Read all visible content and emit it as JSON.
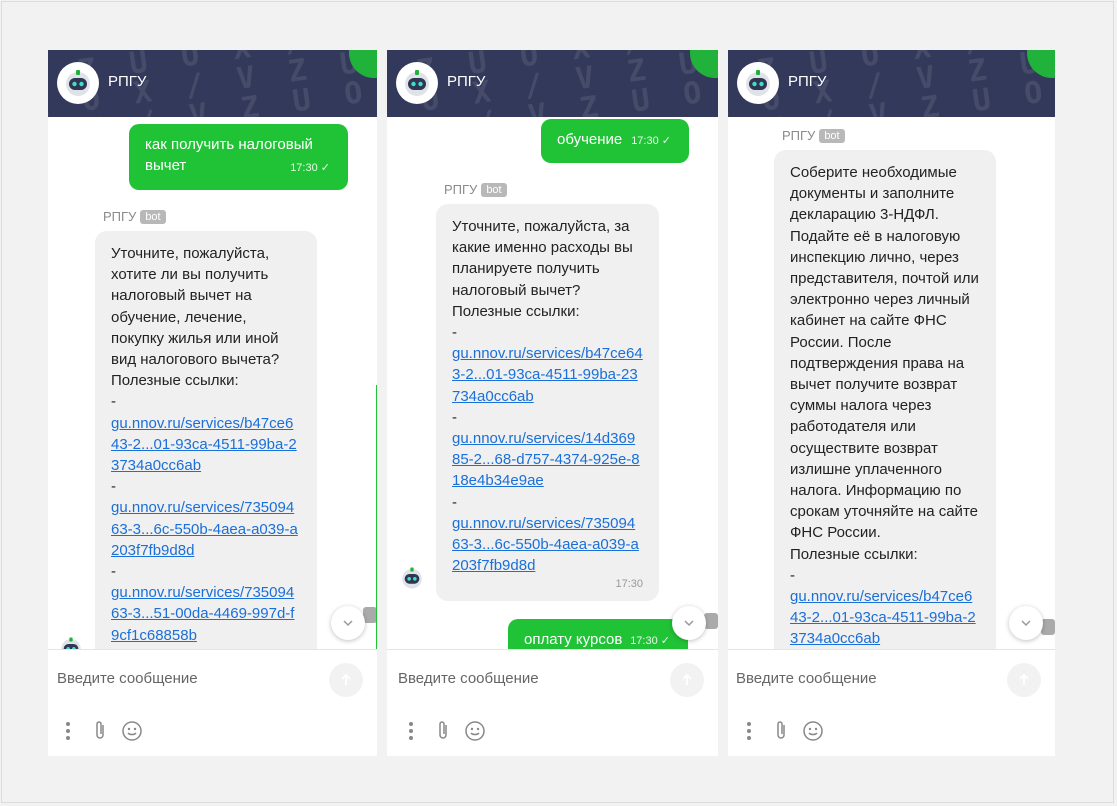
{
  "chat": {
    "title": "РПГУ",
    "input_placeholder": "Введите сообщение",
    "bot_tag": "bot"
  },
  "panels": [
    {
      "user_messages": [
        {
          "text": "как получить налоговый вычет",
          "time": "17:30"
        }
      ],
      "bot_message": {
        "sender": "РПГУ",
        "lines": [
          "Уточните, пожалуйста, хотите ли вы получить налоговый вычет на обучение, лечение, покупку жилья или иной вид налогового вычета?",
          "Полезные ссылки:",
          "-"
        ],
        "links": [
          "gu.nnov.ru/services/b47ce643-2...01-93ca-4511-99ba-23734a0cc6ab",
          "gu.nnov.ru/services/73509463-3...6c-550b-4aea-a039-a203f7fb9d8d",
          "gu.nnov.ru/services/73509463-3...51-00da-4469-997d-f9cf1c68858b"
        ]
      }
    },
    {
      "user_messages": [
        {
          "text": "обучение",
          "time": "17:30"
        },
        {
          "text": "оплату курсов",
          "time": "17:30"
        }
      ],
      "bot_message": {
        "sender": "РПГУ",
        "lines": [
          "Уточните, пожалуйста, за какие именно расходы вы планируете получить налоговый вычет?",
          "Полезные ссылки:",
          "-"
        ],
        "links": [
          "gu.nnov.ru/services/b47ce643-2...01-93ca-4511-99ba-23734a0cc6ab",
          "gu.nnov.ru/services/14d36985-2...68-d757-4374-925e-818e4b34e9ae",
          "gu.nnov.ru/services/73509463-3...6c-550b-4aea-a039-a203f7fb9d8d"
        ],
        "time": "17:30"
      }
    },
    {
      "user_messages": [],
      "bot_message": {
        "sender": "РПГУ",
        "lines": [
          "Соберите необходимые документы и заполните декларацию 3-НДФЛ. Подайте её в налоговую инспекцию лично, через представителя, почтой или электронно через личный кабинет на сайте ФНС России. После подтверждения права на вычет получите возврат суммы налога через работодателя или осуществите возврат излишне уплаченного налога. Информацию по срокам уточняйте на сайте ФНС России.",
          "Полезные ссылки:",
          "-"
        ],
        "links": [
          "gu.nnov.ru/services/b47ce643-2...01-93ca-4511-99ba-23734a0cc6ab"
        ]
      }
    }
  ],
  "icons": [
    "bot-avatar-icon",
    "check-icon",
    "chevron-down-icon",
    "send-arrow-icon",
    "more-vertical-icon",
    "paperclip-icon",
    "smiley-icon"
  ],
  "colors": {
    "header": "#33395a",
    "accent": "#21c336",
    "link": "#1a6fd8",
    "bot_bubble": "#f0f0f0"
  }
}
